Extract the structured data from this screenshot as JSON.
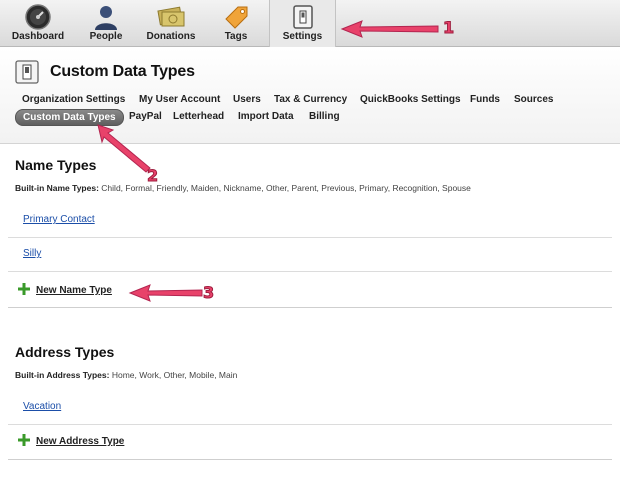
{
  "topnav": {
    "items": [
      {
        "label": "Dashboard"
      },
      {
        "label": "People"
      },
      {
        "label": "Donations"
      },
      {
        "label": "Tags"
      },
      {
        "label": "Settings"
      }
    ]
  },
  "callouts": [
    "1",
    "2",
    "3"
  ],
  "header": {
    "title": "Custom Data Types",
    "subnav": [
      "Organization Settings",
      "My User Account",
      "Users",
      "Tax & Currency",
      "QuickBooks Settings",
      "Funds",
      "Sources",
      "Custom Data Types",
      "PayPal",
      "Letterhead",
      "Import Data",
      "Billing"
    ]
  },
  "name_types": {
    "title": "Name Types",
    "builtin_label": "Built-in Name Types:",
    "builtin_values": "Child, Formal, Friendly, Maiden, Nickname, Other, Parent, Previous, Primary, Recognition, Spouse",
    "items": [
      "Primary Contact",
      "Silly"
    ],
    "new_label": "New Name Type"
  },
  "address_types": {
    "title": "Address Types",
    "builtin_label": "Built-in Address Types:",
    "builtin_values": "Home, Work, Other, Mobile, Main",
    "items": [
      "Vacation"
    ],
    "new_label": "New Address Type"
  },
  "colors": {
    "accent": "#e8426a",
    "link": "#1b4ea8",
    "plus": "#3a9a2a"
  }
}
